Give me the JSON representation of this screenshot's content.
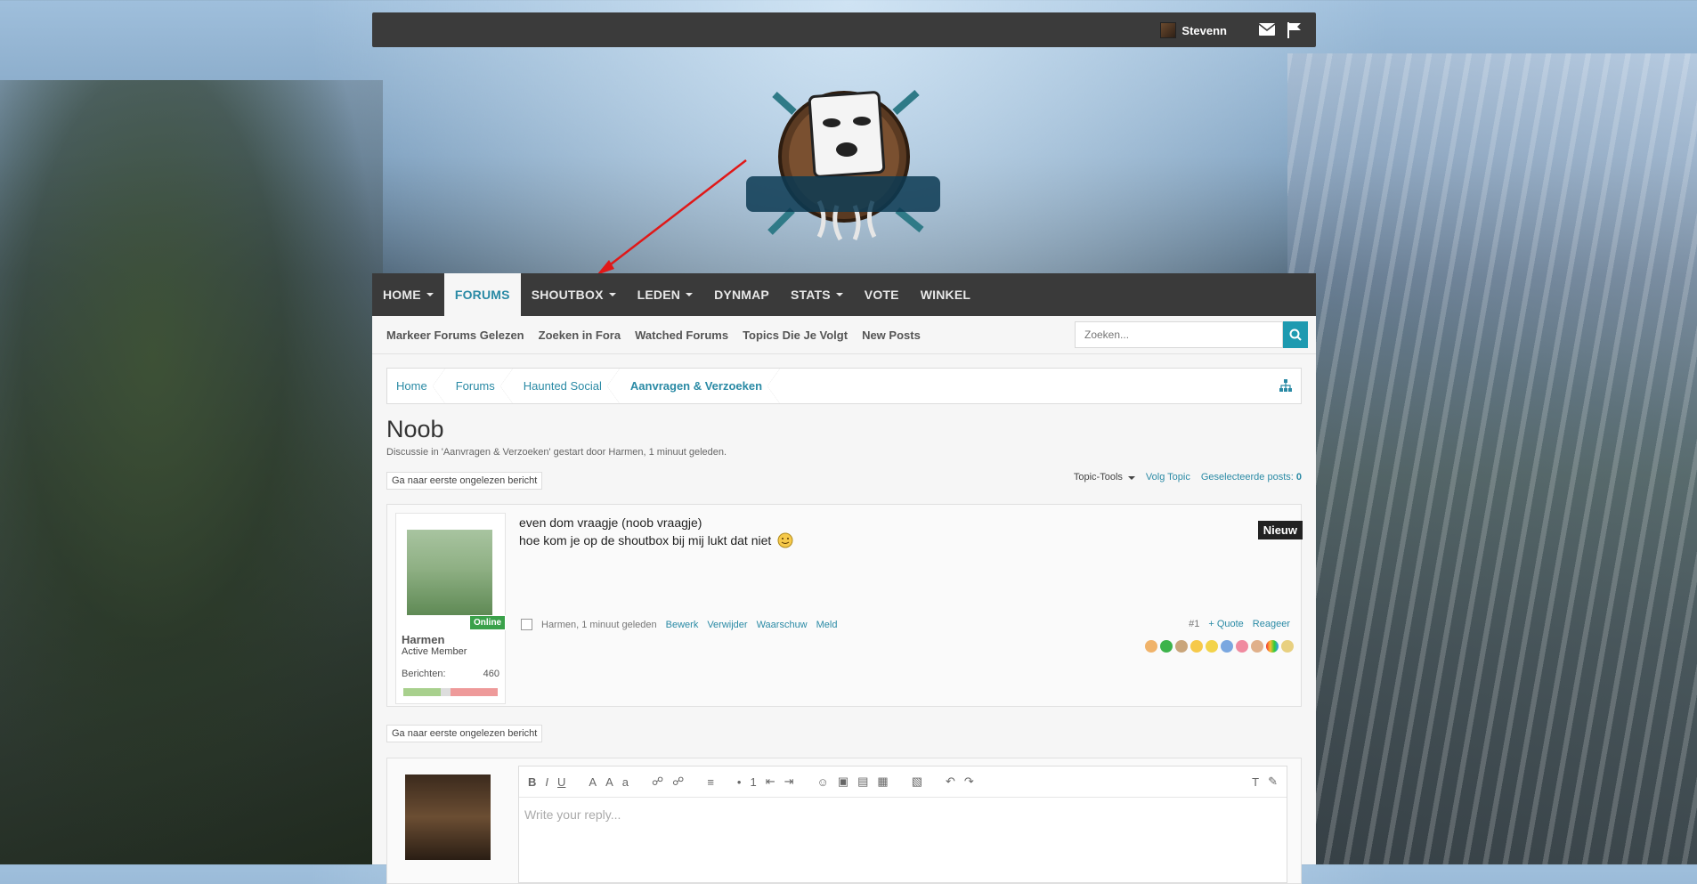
{
  "topbar": {
    "username": "Stevenn"
  },
  "nav": {
    "items": [
      {
        "label": "HOME",
        "dropdown": true
      },
      {
        "label": "FORUMS",
        "active": true
      },
      {
        "label": "SHOUTBOX",
        "dropdown": true
      },
      {
        "label": "LEDEN",
        "dropdown": true
      },
      {
        "label": "DYNMAP"
      },
      {
        "label": "STATS",
        "dropdown": true
      },
      {
        "label": "VOTE"
      },
      {
        "label": "WINKEL"
      }
    ]
  },
  "subnav": {
    "links": [
      "Markeer Forums Gelezen",
      "Zoeken in Fora",
      "Watched Forums",
      "Topics Die Je Volgt",
      "New Posts"
    ],
    "search_placeholder": "Zoeken..."
  },
  "breadcrumb": [
    "Home",
    "Forums",
    "Haunted Social",
    "Aanvragen & Verzoeken"
  ],
  "thread": {
    "title": "Noob",
    "byline": "Discussie in 'Aanvragen & Verzoeken' gestart door Harmen, 1 minuut geleden.",
    "jump_button": "Ga naar eerste ongelezen bericht",
    "tools_label": "Topic-Tools",
    "follow_label": "Volg Topic",
    "selected_label": "Geselecteerde posts:",
    "selected_count": "0"
  },
  "post": {
    "author": "Harmen",
    "role": "Active Member",
    "status": "Online",
    "stat_label": "Berichten:",
    "stat_value": "460",
    "line1": "even dom vraagje (noob vraagje)",
    "line2": "hoe kom je op de shoutbox bij mij lukt dat niet",
    "new_badge": "Nieuw",
    "meta_time": "Harmen, 1 minuut geleden",
    "meta_links": [
      "Bewerk",
      "Verwijder",
      "Waarschuw",
      "Meld"
    ],
    "number": "#1",
    "quote": "+ Quote",
    "reply": "Reageer"
  },
  "editor": {
    "placeholder": "Write your reply..."
  },
  "colors": {
    "accent": "#2a8aa5",
    "nav_bg": "#3a3a3a",
    "online": "#3aa14a"
  }
}
